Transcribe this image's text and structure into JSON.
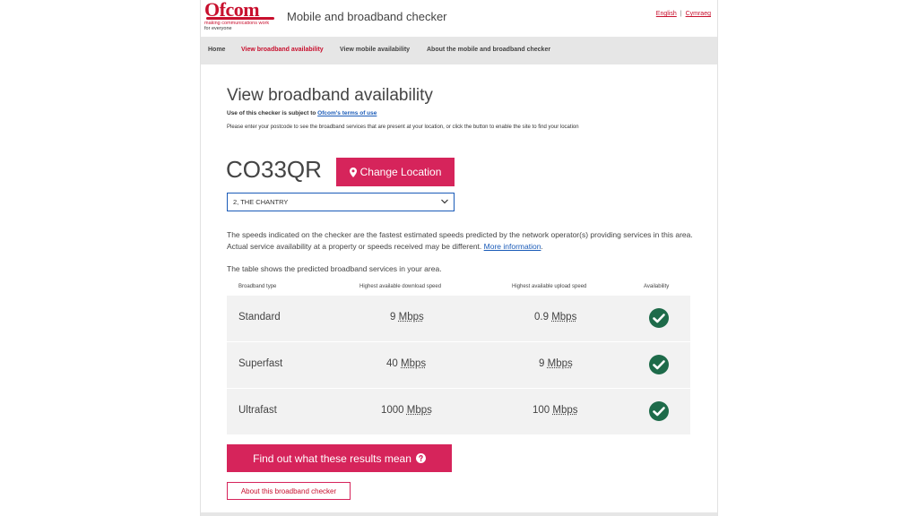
{
  "header": {
    "logo_word": "Ofcom",
    "logo_tag_1": "making communications work",
    "logo_tag_2": "for everyone",
    "app_title": "Mobile and broadband checker",
    "lang_english": "English",
    "lang_sep": "|",
    "lang_welsh": "Cymraeg"
  },
  "nav": {
    "items": [
      {
        "label": "Home",
        "active": false
      },
      {
        "label": "View broadband availability",
        "active": true
      },
      {
        "label": "View mobile availability",
        "active": false
      },
      {
        "label": "About the mobile and broadband checker",
        "active": false
      }
    ]
  },
  "main": {
    "title": "View broadband availability",
    "terms_prefix": "Use of this checker is subject to",
    "terms_link": "Ofcom's terms of use",
    "instructions": "Please enter your postcode to see the broadband services that are present at your location, or click the button to enable the site to find your location",
    "postcode": "CO33QR",
    "change_location_label": "Change Location",
    "address_selected": "2, THE CHANTRY",
    "note_text": "The speeds indicated on the checker are the fastest estimated speeds predicted by the network operator(s) providing services in this area. Actual service availability at a property or speeds received may be different.",
    "note_link": "More information",
    "note_end": ".",
    "table_intro": "The table shows the predicted broadband services in your area."
  },
  "table": {
    "headers": [
      "Broadband type",
      "Highest available download speed",
      "Highest available upload speed",
      "Availability"
    ],
    "unit": "Mbps",
    "rows": [
      {
        "type": "Standard",
        "download": "9",
        "upload": "0.9",
        "available": true
      },
      {
        "type": "Superfast",
        "download": "40",
        "upload": "9",
        "available": true
      },
      {
        "type": "Ultrafast",
        "download": "1000",
        "upload": "100",
        "available": true
      }
    ]
  },
  "actions": {
    "results_label": "Find out what these results mean",
    "about_label": "About this broadband checker"
  },
  "colors": {
    "brand": "#c8102e",
    "button": "#d6245b",
    "link": "#1a5bb8",
    "check": "#1e6b4a"
  },
  "icons": {
    "change_location": "map-pin-icon",
    "select": "chevron-down-icon",
    "availability": "check-circle-icon",
    "results": "question-circle-icon"
  }
}
